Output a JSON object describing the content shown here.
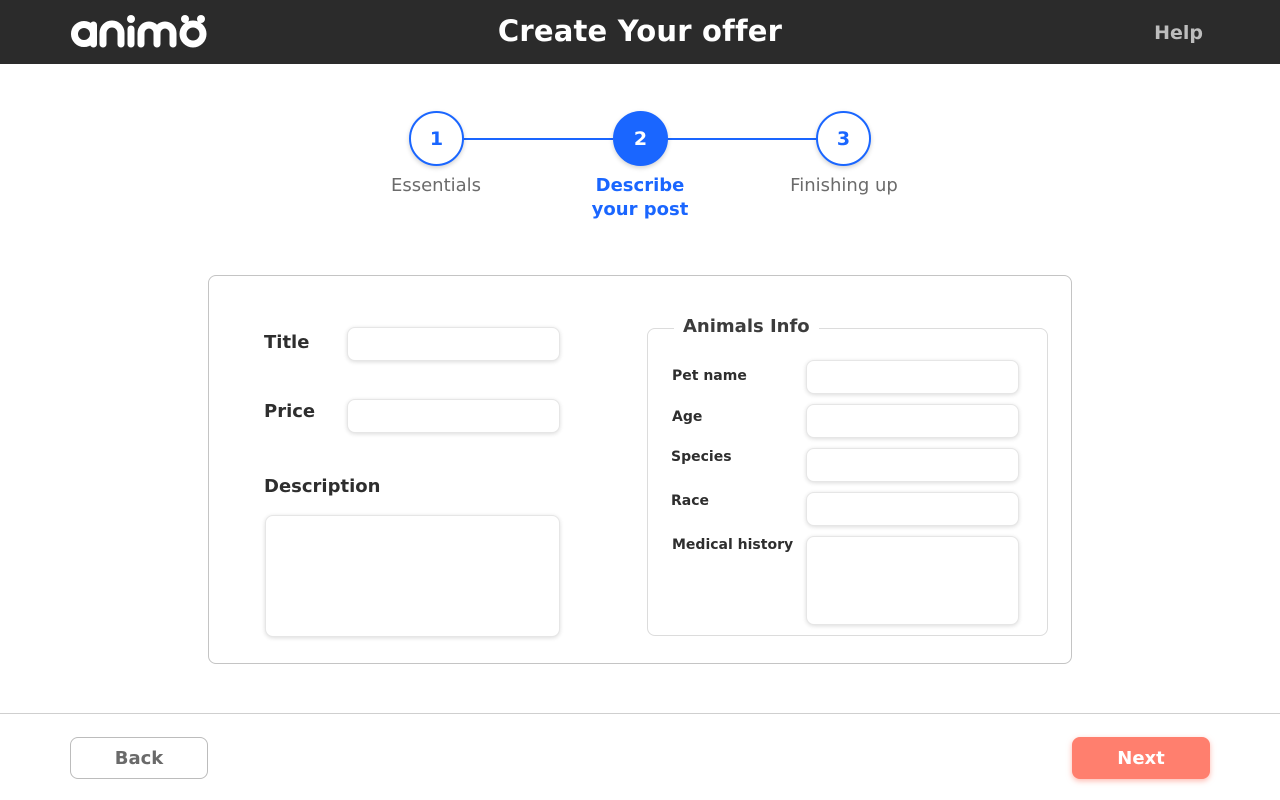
{
  "header": {
    "logo_text": "animo",
    "title": "Create Your offer",
    "help_label": "Help"
  },
  "stepper": {
    "current_step": 2,
    "steps": [
      {
        "number": "1",
        "label_line1": "Essentials",
        "label_line2": ""
      },
      {
        "number": "2",
        "label_line1": "Describe",
        "label_line2": "your post"
      },
      {
        "number": "3",
        "label_line1": "Finishing up",
        "label_line2": ""
      }
    ]
  },
  "form": {
    "title_label": "Title",
    "title_value": "",
    "price_label": "Price",
    "price_value": "",
    "description_label": "Description",
    "description_value": "",
    "animals_info": {
      "legend": "Animals Info",
      "pet_name_label": "Pet name",
      "pet_name_value": "",
      "age_label": "Age",
      "age_value": "",
      "species_label": "Species",
      "species_value": "",
      "race_label": "Race",
      "race_value": "",
      "medical_history_label": "Medical history",
      "medical_history_value": ""
    }
  },
  "footer": {
    "back_label": "Back",
    "next_label": "Next"
  },
  "colors": {
    "accent": "#1a66ff",
    "next_button": "#ff7f6e",
    "topbar": "#2b2b2b"
  }
}
